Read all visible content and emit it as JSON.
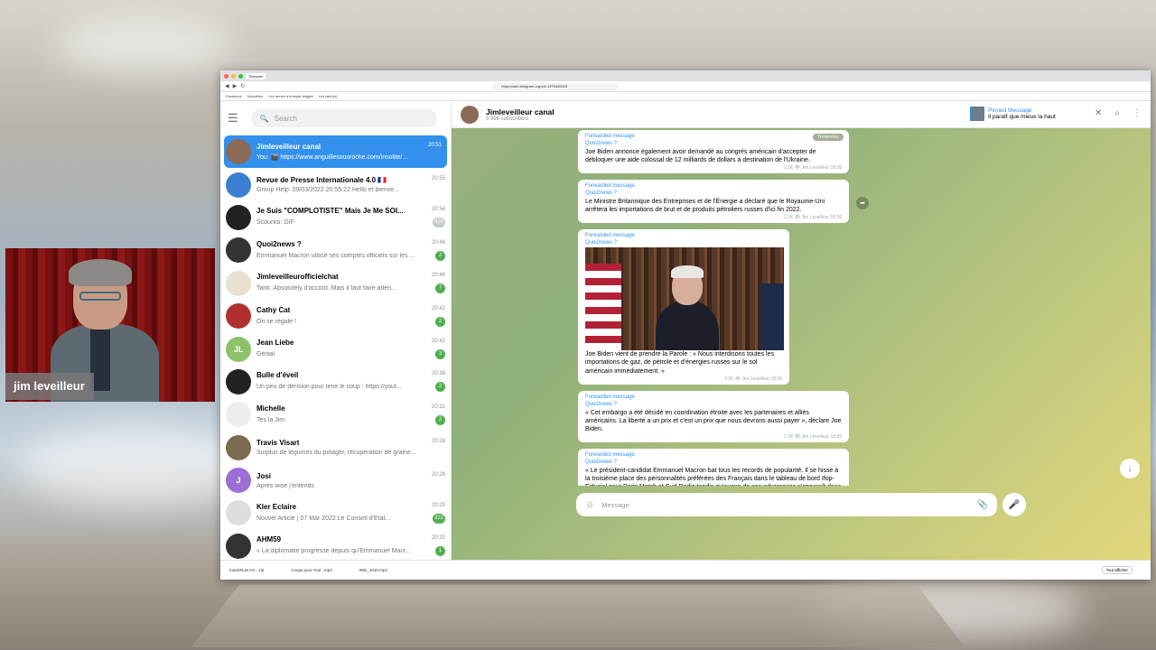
{
  "webcam": {
    "name": "jim leveilleur"
  },
  "browser": {
    "tabs": [
      "Telegram"
    ],
    "url": "https://web.telegram.org/z/#-1379485929",
    "bookmarks": [
      "Facebook",
      "Nouvelles",
      "Les armes à énergie dirigée",
      "Les alien(s)"
    ],
    "downloads": [
      "InsuloNow-AC...zip",
      "Coups pour Youl...mp4",
      "IMG_1010.mp4"
    ],
    "downloads_all": "Tout afficher"
  },
  "sidebar": {
    "menu_icon": "hamburger-icon",
    "search_placeholder": "Search",
    "chats": [
      {
        "name": "Jimleveilleur canal",
        "time": "20:51",
        "msg": "You: 🎬 https://www.anguillesousroche.com/insolite/...",
        "badge": "",
        "color": "#8b6b55",
        "initials": ""
      },
      {
        "name": "Revue de Presse Internationale 4.0 🇫🇷",
        "time": "20:55",
        "msg": "Group Help: 09/03/2022 20:55:22 Hello et bienve...",
        "badge": "",
        "badge_muted": true,
        "color": "#3c7fd0",
        "initials": ""
      },
      {
        "name": "Je Suis \"COMPLOTISTE\" Mais Je Me SOI...",
        "time": "20:54",
        "msg": "Scounisi: GIF",
        "badge": "428",
        "badge_muted": true,
        "color": "#222",
        "initials": ""
      },
      {
        "name": "Quoi2news ?",
        "time": "20:46",
        "msg": "Emmanuel Macron utilise ses comptes officiels sur les ...",
        "badge": "2",
        "color": "#333",
        "initials": ""
      },
      {
        "name": "Jimleveilleurofficielchat",
        "time": "20:46",
        "msg": "Tarik: Absolutely d'accord. Mais il faut faire atten...",
        "badge": "7",
        "color": "#e8e0d0",
        "initials": ""
      },
      {
        "name": "Cathy Cat",
        "time": "20:42",
        "msg": "On se régale !",
        "badge": "2",
        "color": "#b03030",
        "initials": ""
      },
      {
        "name": "Jean Liebe",
        "time": "20:42",
        "msg": "Génial",
        "badge": "3",
        "color": "#8dc26a",
        "initials": "JL"
      },
      {
        "name": "Bulle d'éveil",
        "time": "20:39",
        "msg": "Un peu de dérision pour tenir le coup : https://yout...",
        "badge": "2",
        "color": "#222",
        "initials": ""
      },
      {
        "name": "Michelle",
        "time": "20:31",
        "msg": "Tes la Jim",
        "badge": "2",
        "color": "#eee",
        "initials": ""
      },
      {
        "name": "Travis Visart",
        "time": "20:28",
        "msg": "Surplus de légumes du potager, récupération de graine...",
        "badge": "",
        "color": "#7a6a50",
        "initials": ""
      },
      {
        "name": "Josi",
        "time": "20:26",
        "msg": "Après wise j'entends",
        "badge": "",
        "color": "#9b6fd6",
        "initials": "J"
      },
      {
        "name": "Kler Eclaire",
        "time": "20:25",
        "msg": "Nouvel Article | 07 Mar 2022 Le Conseil d'Etat...",
        "badge": "322",
        "color": "#ddd",
        "initials": ""
      },
      {
        "name": "AHM59",
        "time": "20:20",
        "msg": "« La diplomatie progresse depuis qu'Emmanuel Macr...",
        "badge": "1",
        "color": "#333",
        "initials": ""
      }
    ]
  },
  "channel": {
    "title": "Jimleveilleur canal",
    "subscribers": "9 996 subscribers",
    "pinned_title": "Pinned Message",
    "pinned_text": "Il paraît que mieux la haut",
    "date_pill": "Yesterday",
    "composer_placeholder": "Message",
    "messages": [
      {
        "fwd": "Forwarded message",
        "from": "Quoi2news ?",
        "text": "Joe Biden annonce également avoir demandé au congrès américain d'accepter de débloquer une aide colossal de 12 milliards de dollars à destination de l'Ukraine.",
        "meta": "2.2K 👁 Jim Leveilleur 18:38"
      },
      {
        "fwd": "Forwarded message",
        "from": "Quoi2news ?",
        "text": "Le Ministre Britannique des Entreprises et de l'Énergie a déclaré que le Royaume-Uni arrêtera les importations de brut et de produits pétroliers russes d'ici fin 2022.",
        "meta": "2.2K 👁 Jim Leveilleur 18:38"
      },
      {
        "fwd": "Forwarded message",
        "from": "Quoi2news ?",
        "text": "Joe Biden vient de prendre la Parole : « Nous interdisons toutes les importations de gaz, de pétrole et d'énergies russes sur le sol américain immédiatement. »",
        "meta": "2.2K 👁 Jim Leveilleur 18:38"
      },
      {
        "fwd": "Forwarded message",
        "from": "Quoi2news ?",
        "text": "« Cet embargo a été décidé en coordination étroite avec les partenaires et alliés américains. La liberté a un prix et c'est un prix que nous devrons aussi payer », déclare Joe Biden.",
        "meta": "2.2K 👁 Jim Leveilleur 18:39"
      },
      {
        "fwd": "Forwarded message",
        "from": "Quoi2news ?",
        "text": "« Le président-candidat Emmanuel Macron bat tous les records de popularité. Il se hisse à la troisième place des personnalités préférées des Français dans le tableau de bord Ifop-Fiducial pour Paris Match et Sud-Radio tandis qu'aucun de ses adversaires n'apparaît dans les dix premiers du classement. » Macron gagne",
        "meta": ""
      }
    ]
  }
}
